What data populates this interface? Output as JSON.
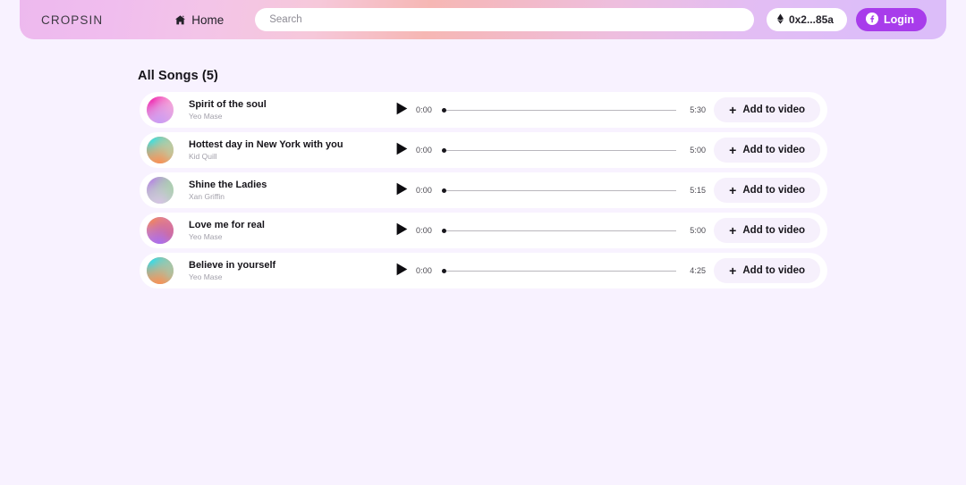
{
  "header": {
    "brand": "CROPSIN",
    "nav": {
      "home_label": "Home",
      "home_icon": "home-icon"
    },
    "search": {
      "value": "",
      "placeholder": "Search"
    },
    "wallet": {
      "label": "0x2...85a",
      "icon": "ethereum-diamond-icon"
    },
    "login": {
      "label": "Login",
      "icon": "facebook-icon",
      "color": "#a83ceb"
    }
  },
  "main": {
    "section_title": "All Songs (5)",
    "songs": [
      {
        "title": "Spirit of the soul",
        "artist": "Yeo Mase",
        "current_time": "0:00",
        "duration": "5:30",
        "progress": 0,
        "play_icon": "play-icon",
        "add_label": "Add to video",
        "add_icon": "plus-icon",
        "art": {
          "base": "#f5bfe0",
          "blob1": "#f02fb2",
          "blob2": "#f7a8d8",
          "blob3": "#c79bf5"
        }
      },
      {
        "title": "Hottest day in New York with you",
        "artist": "Kid Quill",
        "current_time": "0:00",
        "duration": "5:00",
        "progress": 0,
        "play_icon": "play-icon",
        "add_label": "Add to video",
        "add_icon": "plus-icon",
        "art": {
          "base": "#f79a5e",
          "blob1": "#3ee0e0",
          "blob2": "#9fe8c8",
          "blob3": "#f98f55"
        }
      },
      {
        "title": "Shine the Ladies",
        "artist": "Xan Griffin",
        "current_time": "0:00",
        "duration": "5:15",
        "progress": 0,
        "play_icon": "play-icon",
        "add_label": "Add to video",
        "add_icon": "plus-icon",
        "art": {
          "base": "#b9d9ba",
          "blob1": "#b58ae0",
          "blob2": "#9fd3a0",
          "blob3": "#d8c3e8"
        }
      },
      {
        "title": "Love me for real",
        "artist": "Yeo Mase",
        "current_time": "0:00",
        "duration": "5:00",
        "progress": 0,
        "play_icon": "play-icon",
        "add_label": "Add to video",
        "add_icon": "plus-icon",
        "art": {
          "base": "#c48df0",
          "blob1": "#f0845f",
          "blob2": "#e86a6a",
          "blob3": "#a86ef0"
        }
      },
      {
        "title": "Believe in yourself",
        "artist": "Yeo Mase",
        "current_time": "0:00",
        "duration": "4:25",
        "progress": 0,
        "play_icon": "play-icon",
        "add_label": "Add to video",
        "add_icon": "plus-icon",
        "art": {
          "base": "#f79a5e",
          "blob1": "#34dcea",
          "blob2": "#7fe0d0",
          "blob3": "#f98f55"
        }
      }
    ]
  }
}
